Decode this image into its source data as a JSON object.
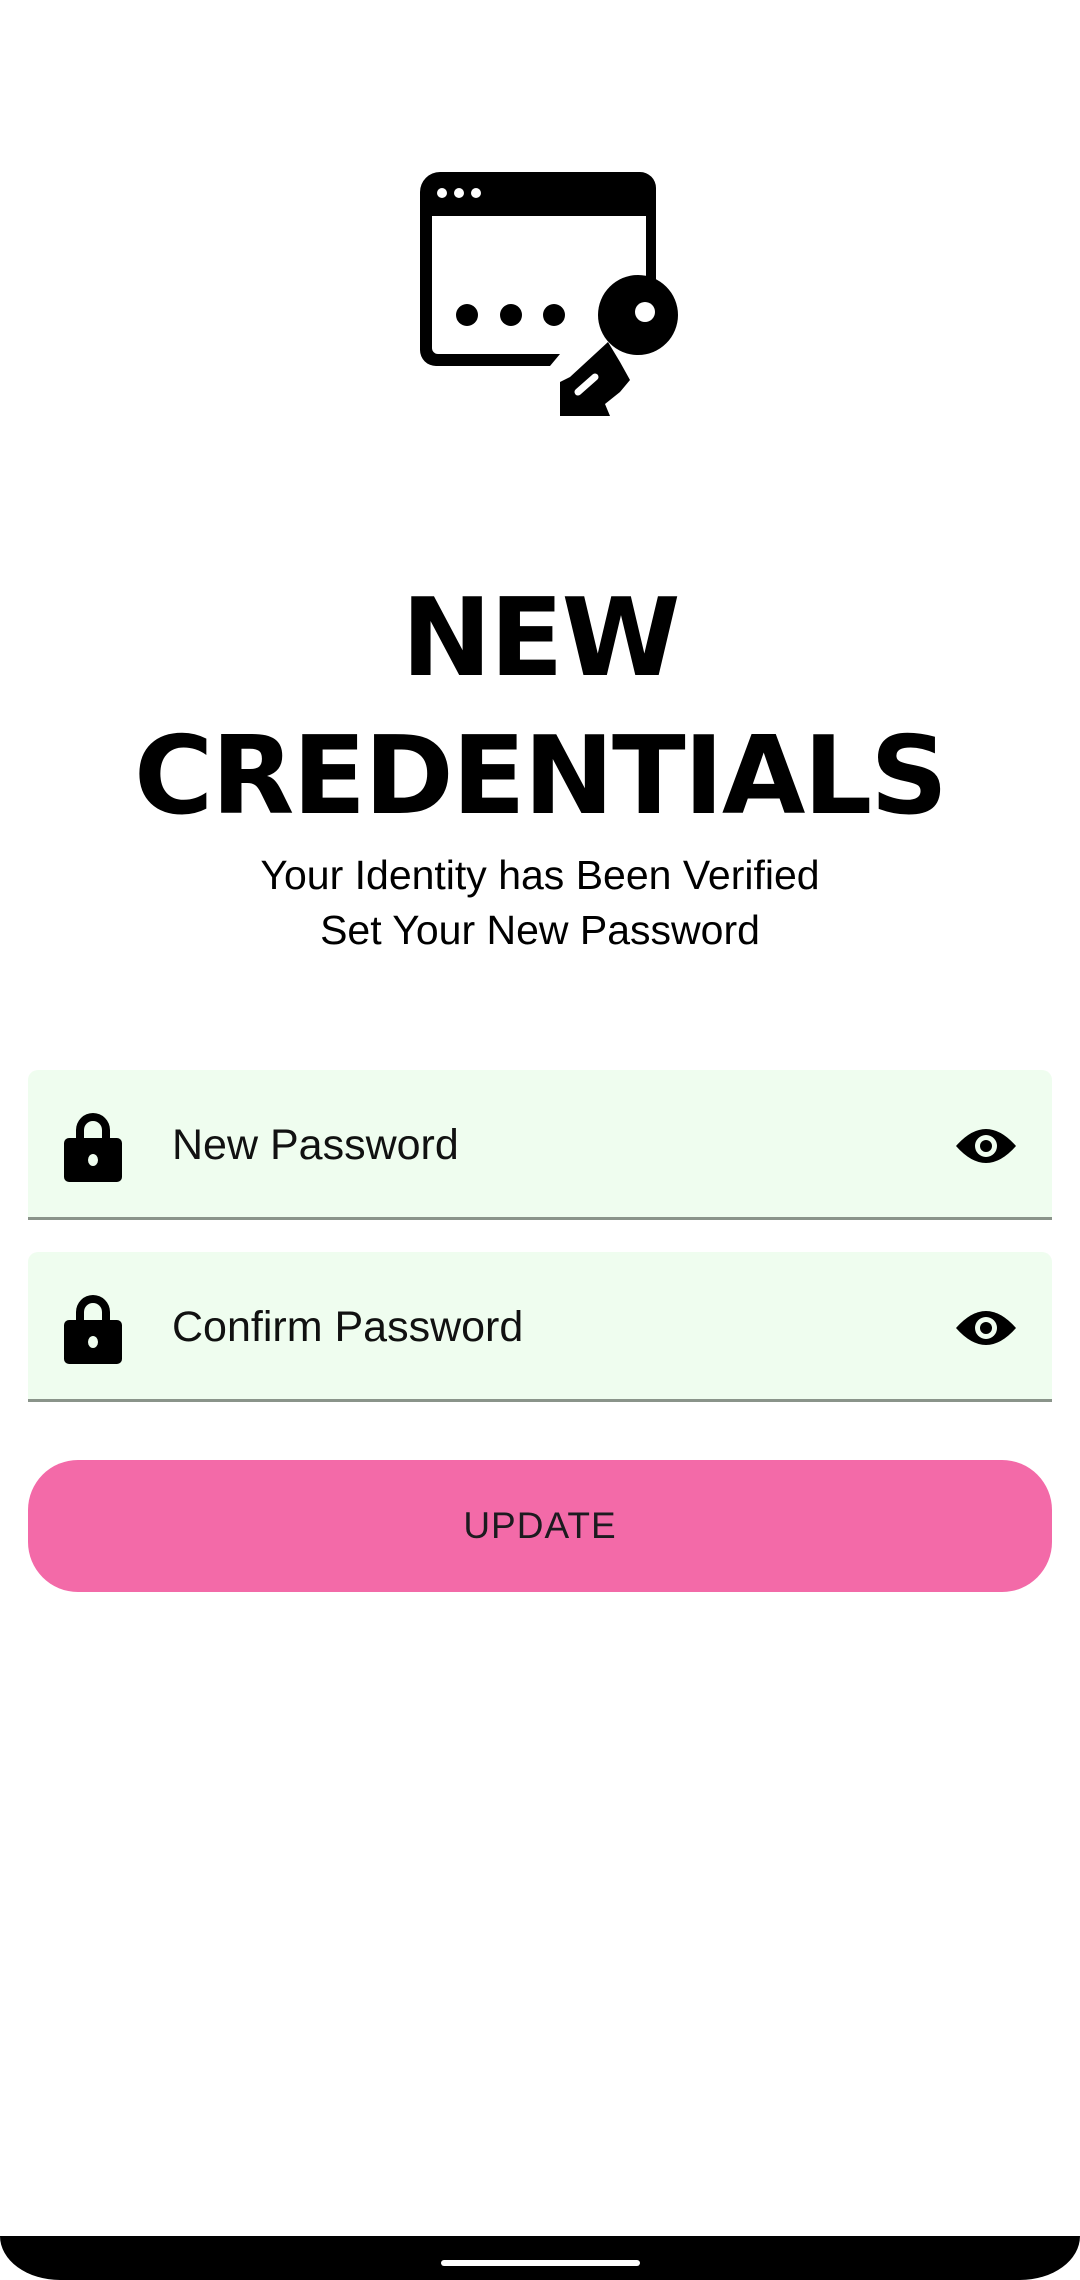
{
  "header": {
    "logo_icon": "browser-password-key-icon",
    "title_line1": "NEW",
    "title_line2": "CREDENTIALS",
    "subtitle_line1": "Your Identity has Been Verified",
    "subtitle_line2": "Set Your New Password"
  },
  "form": {
    "new_password": {
      "placeholder": "New Password",
      "icon": "lock-icon",
      "toggle_icon": "eye-icon"
    },
    "confirm_password": {
      "placeholder": "Confirm Password",
      "icon": "lock-icon",
      "toggle_icon": "eye-icon"
    },
    "submit_label": "UPDATE"
  },
  "colors": {
    "accent": "#f36aa8",
    "field_bg": "#effdef",
    "underline": "#8a948a"
  }
}
